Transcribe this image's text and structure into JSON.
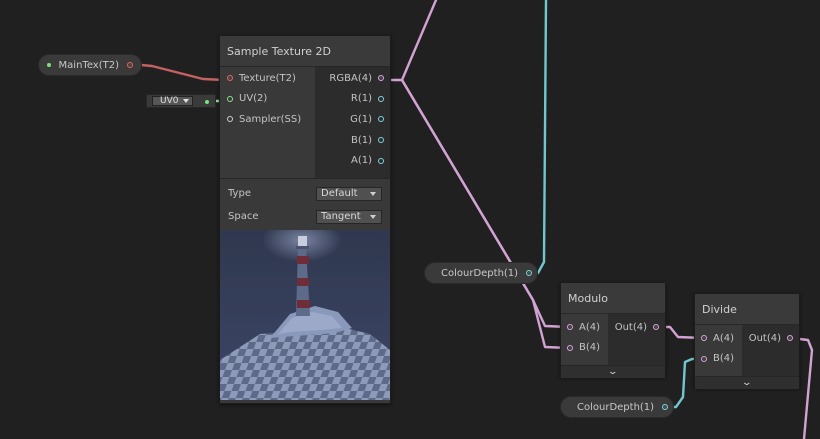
{
  "colors": {
    "background": "#202020",
    "texture_wire": "#c46262",
    "vector4_wire": "#d2a3d2",
    "float_wire": "#71c7cc",
    "vector2_wire": "#8fe08f"
  },
  "properties": {
    "maintex": {
      "label": "MainTex(T2)"
    },
    "colourdepth_top": {
      "label": "ColourDepth(1)"
    },
    "colourdepth_bottom": {
      "label": "ColourDepth(1)"
    }
  },
  "uv_input": {
    "value": "UV0"
  },
  "sample_texture": {
    "title": "Sample Texture 2D",
    "inputs": [
      "Texture(T2)",
      "UV(2)",
      "Sampler(SS)"
    ],
    "outputs": [
      "RGBA(4)",
      "R(1)",
      "G(1)",
      "B(1)",
      "A(1)"
    ],
    "type_label": "Type",
    "type_value": "Default",
    "space_label": "Space",
    "space_value": "Tangent",
    "preview_icon": "lighthouse-preview-image"
  },
  "modulo": {
    "title": "Modulo",
    "inputs": [
      "A(4)",
      "B(4)"
    ],
    "output": "Out(4)",
    "expand_icon": "chevron-down-icon"
  },
  "divide": {
    "title": "Divide",
    "inputs": [
      "A(4)",
      "B(4)"
    ],
    "output": "Out(4)",
    "expand_icon": "chevron-down-icon"
  }
}
